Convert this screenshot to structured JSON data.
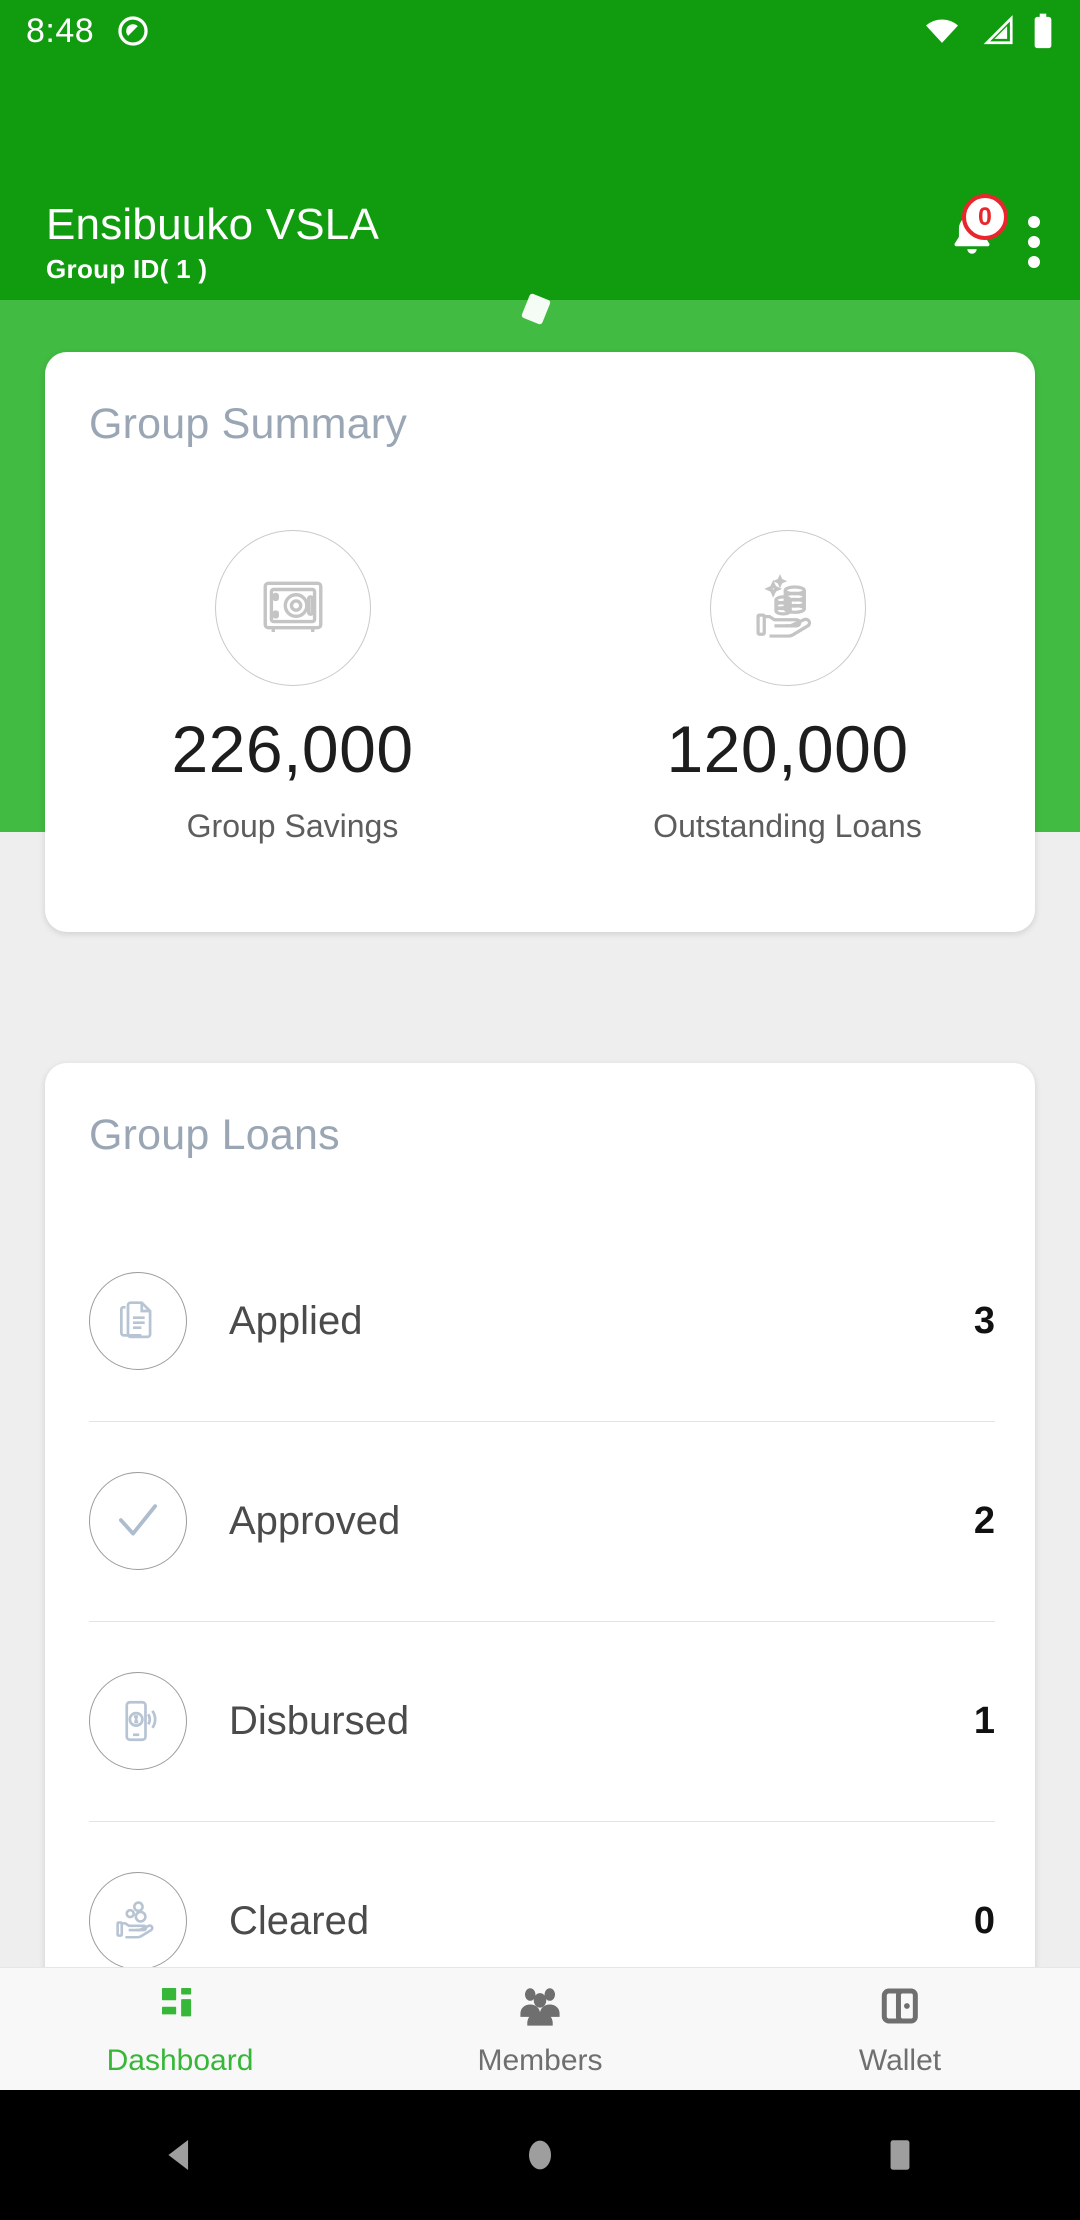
{
  "status_bar": {
    "time": "8:48",
    "icons": [
      "do-not-disturb-icon",
      "wifi-icon",
      "cellular-signal-icon",
      "battery-icon"
    ]
  },
  "app_bar": {
    "title": "Ensibuuko VSLA",
    "subtitle": "Group ID( 1 )",
    "notification_count": "0",
    "overflow_label": "more-options"
  },
  "summary_card": {
    "title": "Group Summary",
    "stats": [
      {
        "icon": "safe-vault-icon",
        "value": "226,000",
        "label": "Group Savings"
      },
      {
        "icon": "hand-coins-icon",
        "value": "120,000",
        "label": "Outstanding Loans"
      }
    ]
  },
  "loans_card": {
    "title": "Group Loans",
    "rows": [
      {
        "icon": "document-icon",
        "label": "Applied",
        "count": "3"
      },
      {
        "icon": "check-icon",
        "label": "Approved",
        "count": "2"
      },
      {
        "icon": "mobile-money-icon",
        "label": "Disbursed",
        "count": "1"
      },
      {
        "icon": "hand-coins-icon",
        "label": "Cleared",
        "count": "0"
      }
    ]
  },
  "bottom_nav": {
    "items": [
      {
        "label": "Dashboard",
        "icon": "grid-dashboard-icon",
        "active": true
      },
      {
        "label": "Members",
        "icon": "people-icon",
        "active": false
      },
      {
        "label": "Wallet",
        "icon": "wallet-icon",
        "active": false
      }
    ]
  },
  "system_nav": {
    "back": "back-triangle-icon",
    "home": "home-circle-icon",
    "recents": "recents-square-icon"
  },
  "colors": {
    "app_bar_green": "#119c10",
    "banner_green": "#42bb42",
    "accent_green": "#37b738",
    "badge_red": "#e8262b",
    "page_background": "#eeeeee",
    "card_title_gray": "#9aa6b4"
  }
}
